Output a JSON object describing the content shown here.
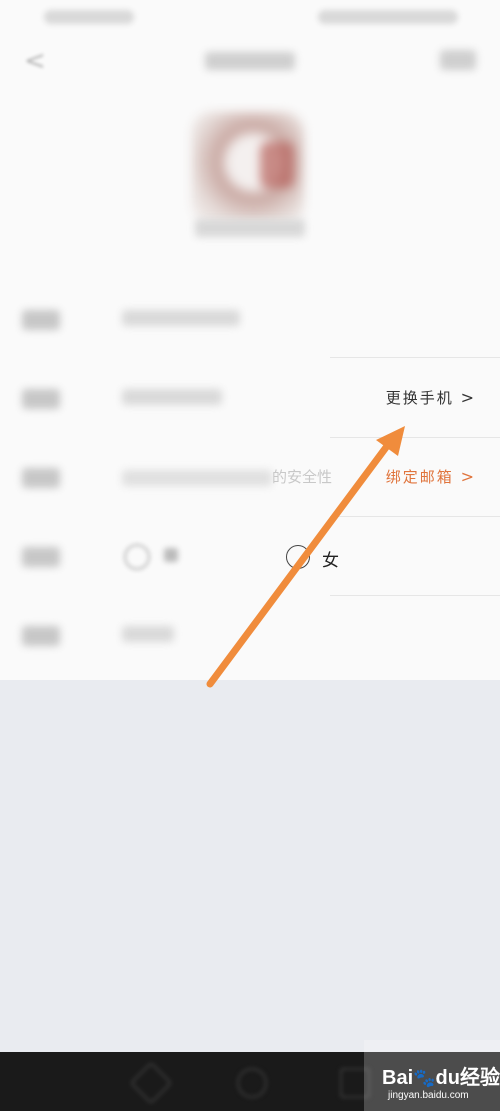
{
  "profile": {
    "rows": {
      "phone": {
        "action": "更换手机",
        "chevron": ">"
      },
      "email": {
        "hint_tail": "的安全性",
        "action": "绑定邮箱",
        "chevron": ">"
      },
      "gender": {
        "female_label": "女"
      }
    }
  },
  "watermark": {
    "brand_a": "Bai",
    "brand_b": "du",
    "brand_c": "经验",
    "site": "jingyan.baidu.com"
  },
  "colors": {
    "accent": "#e0743c",
    "arrow": "#f08c3c"
  }
}
